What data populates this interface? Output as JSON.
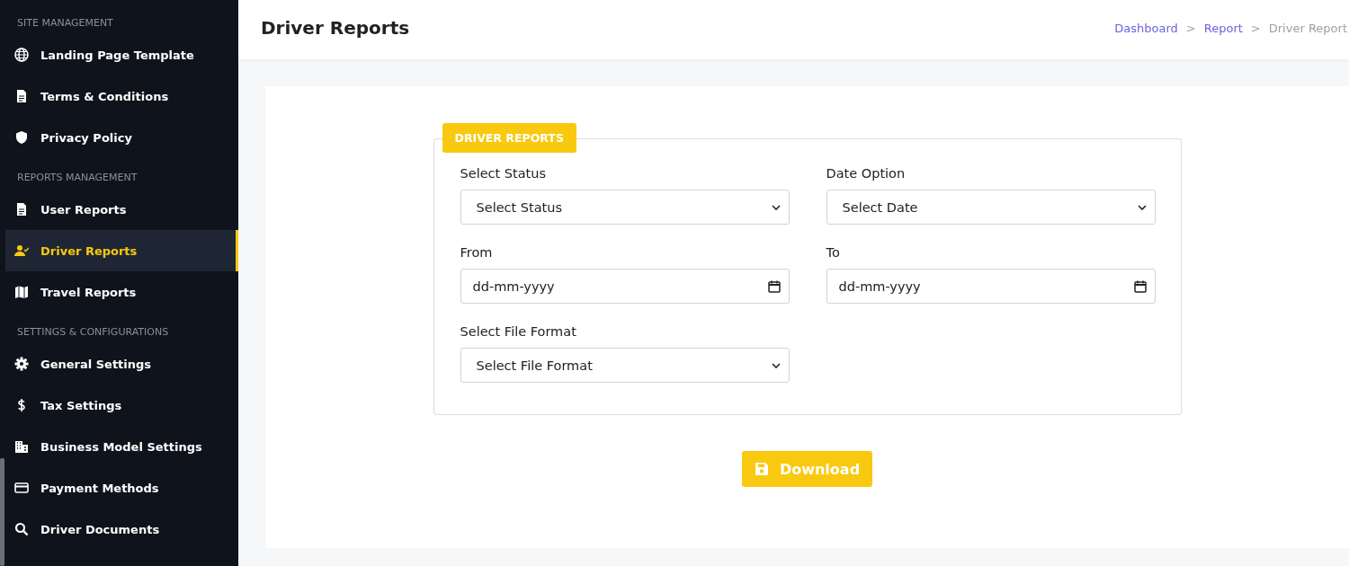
{
  "sidebar": {
    "sections": [
      {
        "heading": "SITE MANAGEMENT",
        "items": [
          {
            "label": "Landing Page Template",
            "selected": false
          },
          {
            "label": "Terms & Conditions",
            "selected": false
          },
          {
            "label": "Privacy Policy",
            "selected": false
          }
        ]
      },
      {
        "heading": "REPORTS MANAGEMENT",
        "items": [
          {
            "label": "User Reports",
            "selected": false
          },
          {
            "label": "Driver Reports",
            "selected": true
          },
          {
            "label": "Travel Reports",
            "selected": false
          }
        ]
      },
      {
        "heading": "SETTINGS & CONFIGURATIONS",
        "items": [
          {
            "label": "General Settings",
            "selected": false
          },
          {
            "label": "Tax Settings",
            "selected": false
          },
          {
            "label": "Business Model Settings",
            "selected": false
          },
          {
            "label": "Payment Methods",
            "selected": false
          },
          {
            "label": "Driver Documents",
            "selected": false
          }
        ]
      }
    ]
  },
  "header": {
    "title": "Driver Reports",
    "breadcrumb": [
      {
        "label": "Dashboard",
        "current": false
      },
      {
        "label": "Report",
        "current": false
      },
      {
        "label": "Driver Report",
        "current": true
      }
    ],
    "separator": ">"
  },
  "form": {
    "legend": "DRIVER REPORTS",
    "fields": [
      {
        "kind": "select",
        "label": "Select Status",
        "placeholder": "Select Status"
      },
      {
        "kind": "select",
        "label": "Date Option",
        "placeholder": "Select Date"
      },
      {
        "kind": "date",
        "label": "From",
        "placeholder": "dd-mm-yyyy"
      },
      {
        "kind": "date",
        "label": "To",
        "placeholder": "dd-mm-yyyy"
      },
      {
        "kind": "select",
        "label": "Select File Format",
        "placeholder": "Select File Format"
      }
    ],
    "button": "Download"
  }
}
